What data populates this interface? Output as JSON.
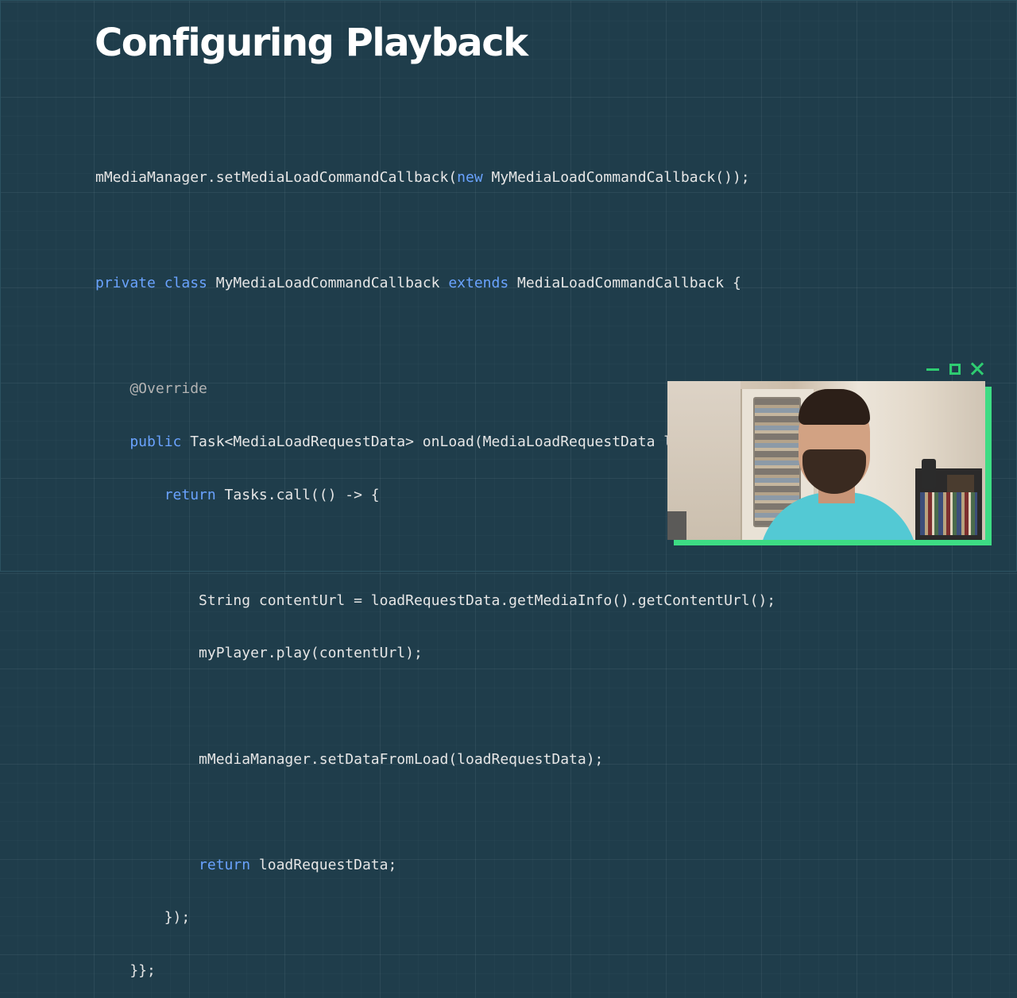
{
  "slide": {
    "title": "Configuring Playback"
  },
  "code": {
    "l1": {
      "a": "mMediaManager.setMediaLoadCommandCallback(",
      "b": "new",
      "c": " MyMediaLoadCommandCallback());"
    },
    "l3": {
      "a": "private class",
      "b": " MyMediaLoadCommandCallback ",
      "c": "extends",
      "d": " MediaLoadCommandCallback {"
    },
    "l5": {
      "a": "    @Override"
    },
    "l6": {
      "a": "    public",
      "b": " Task<MediaLoadRequestData> onLoad(MediaLoadRequestData loadRequestData) {"
    },
    "l7": {
      "a": "        return",
      "b": " Tasks.call(() -> {"
    },
    "l9": {
      "a": "            String contentUrl = loadRequestData.getMediaInfo().getContentUrl();"
    },
    "l10": {
      "a": "            myPlayer.play(contentUrl);"
    },
    "l12": {
      "a": "            mMediaManager.setDataFromLoad(loadRequestData);"
    },
    "l14": {
      "a": "            ",
      "b": "return",
      "c": " loadRequestData;"
    },
    "l15": {
      "a": "        });"
    },
    "l16": {
      "a": "    }};"
    }
  },
  "video_window": {
    "controls": [
      "minimize-icon",
      "maximize-icon",
      "close-icon"
    ],
    "accent_color": "#3ddc84"
  },
  "colors": {
    "background": "#1f3d4b",
    "keyword": "#6aa3ff",
    "code_text": "#e6e6e6"
  }
}
